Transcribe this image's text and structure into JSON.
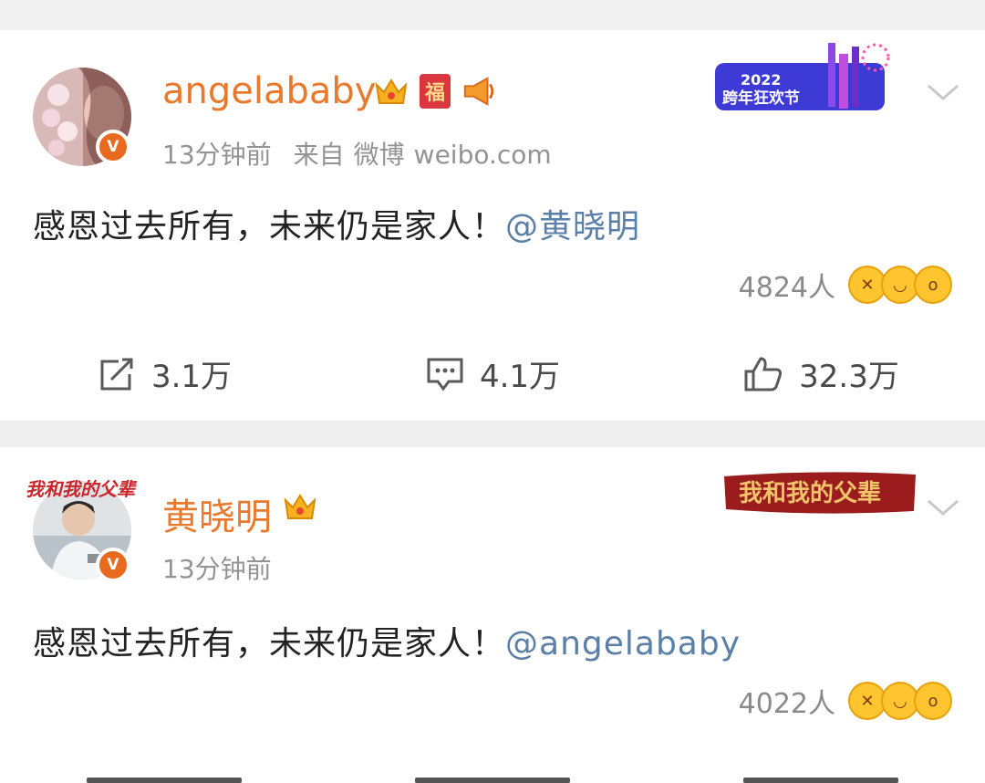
{
  "posts": [
    {
      "name": "angelababy",
      "badges": [
        "crown-icon",
        "fu-badge",
        "horn-icon"
      ],
      "fu_text": "福",
      "verified": "V",
      "time": "13分钟前",
      "source_prefix": "来自",
      "source_app": "微博",
      "source_domain": "weibo.com",
      "banner_year": "2022",
      "banner_text": "跨年狂欢节",
      "content_text": "感恩过去所有，未来仍是家人！",
      "mention": "@黄晓明",
      "reaction_count": "4824人",
      "actions": [
        {
          "icon": "repost-icon",
          "value": "3.1万"
        },
        {
          "icon": "comment-icon",
          "value": "4.1万"
        },
        {
          "icon": "like-icon",
          "value": "32.3万"
        }
      ]
    },
    {
      "name": "黄晓明",
      "avatar_caption": "我和我的父辈",
      "badges": [
        "crown-icon"
      ],
      "verified": "V",
      "time": "13分钟前",
      "banner_text": "我和我的父辈",
      "content_text": "感恩过去所有，未来仍是家人！",
      "mention": "@angelababy",
      "reaction_count": "4022人"
    }
  ],
  "colors": {
    "name": "#e8792d",
    "mention": "#5a7fa8",
    "meta": "#939393",
    "verified": "#e86a1f"
  }
}
